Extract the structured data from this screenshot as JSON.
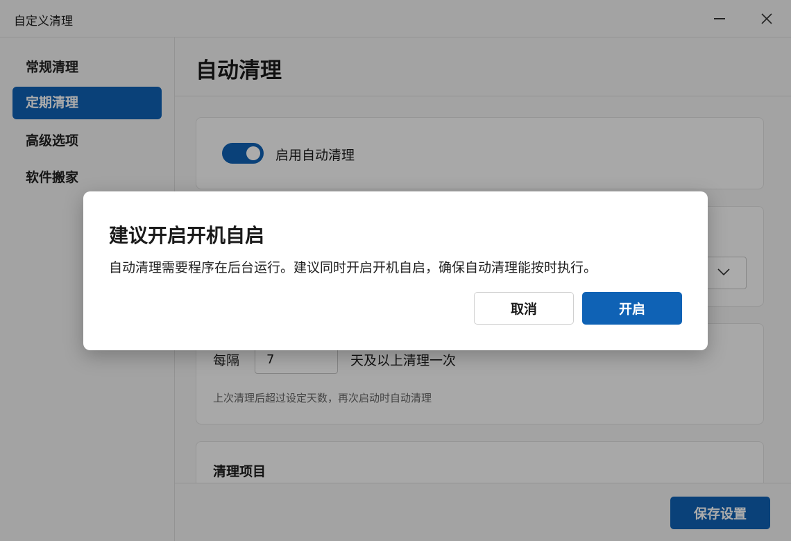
{
  "window": {
    "title": "自定义清理"
  },
  "sidebar": {
    "items": [
      {
        "label": "常规清理",
        "active": false
      },
      {
        "label": "定期清理",
        "active": true
      },
      {
        "label": "高级选项",
        "active": false
      },
      {
        "label": "软件搬家",
        "active": false
      }
    ]
  },
  "main": {
    "title": "自动清理",
    "auto_clean": {
      "toggle_label": "启用自动清理",
      "enabled": true
    },
    "interval": {
      "prefix": "每隔",
      "value": "7",
      "suffix": "天及以上清理一次",
      "hint": "上次清理后超过设定天数，再次启动时自动清理"
    },
    "items_section": {
      "heading": "清理项目"
    },
    "footer": {
      "save_label": "保存设置"
    }
  },
  "dialog": {
    "title": "建议开启开机自启",
    "message": "自动清理需要程序在后台运行。建议同时开启开机自启，确保自动清理能按时执行。",
    "cancel_label": "取消",
    "confirm_label": "开启"
  },
  "colors": {
    "accent": "#0f62b5",
    "background": "#f3f3f3",
    "card": "#fbfbfb"
  },
  "icons": {
    "minimize": "minimize-icon",
    "close": "close-icon",
    "dropdown": "chevron-down-icon"
  }
}
